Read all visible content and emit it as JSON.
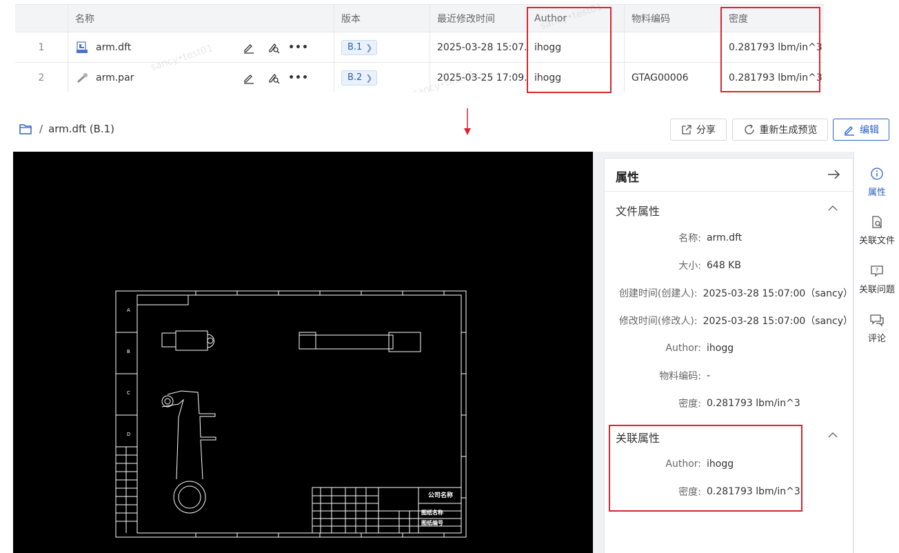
{
  "table": {
    "headers": {
      "name": "名称",
      "version": "版本",
      "modified": "最近修改时间",
      "author": "Author",
      "material_code": "物料编码",
      "density": "密度"
    },
    "rows": [
      {
        "index": "1",
        "name": "arm.dft",
        "icon": "draft-file-icon",
        "version": "B.1",
        "modified": "2025-03-28 15:07...",
        "author": "ihogg",
        "material_code": "",
        "density": "0.281793 lbm/in^3"
      },
      {
        "index": "2",
        "name": "arm.par",
        "icon": "part-file-icon",
        "version": "B.2",
        "modified": "2025-03-25 17:09...",
        "author": "ihogg",
        "material_code": "GTAG00006",
        "density": "0.281793 lbm/in^3"
      }
    ],
    "watermark": "sancy•test01"
  },
  "breadcrumb": {
    "sep": "/",
    "current": "arm.dft (B.1)"
  },
  "toolbar": {
    "share": "分享",
    "regenerate": "重新生成预览",
    "edit": "编辑"
  },
  "drawing": {
    "title_block_company": "公司名称",
    "title_block_drawing_name": "图纸名称",
    "title_block_drawing_no": "图纸编号"
  },
  "panel": {
    "title": "属性",
    "file_section": {
      "title": "文件属性",
      "props": [
        {
          "key": "名称:",
          "value": "arm.dft"
        },
        {
          "key": "大小:",
          "value": "648 KB"
        },
        {
          "key": "创建时间(创建人):",
          "value": "2025-03-28 15:07:00（sancy）"
        },
        {
          "key": "修改时间(修改人):",
          "value": "2025-03-28 15:07:00（sancy）"
        },
        {
          "key": "Author:",
          "value": "ihogg"
        },
        {
          "key": "物料编码:",
          "value": "-"
        },
        {
          "key": "密度:",
          "value": "0.281793 lbm/in^3"
        }
      ]
    },
    "linked_section": {
      "title": "关联属性",
      "props": [
        {
          "key": "Author:",
          "value": "ihogg"
        },
        {
          "key": "密度:",
          "value": "0.281793 lbm/in^3"
        }
      ]
    }
  },
  "rail": {
    "items": [
      {
        "label": "属性",
        "icon": "info-icon",
        "active": true
      },
      {
        "label": "关联文件",
        "icon": "linked-file-icon",
        "active": false
      },
      {
        "label": "关联问题",
        "icon": "question-icon",
        "active": false
      },
      {
        "label": "评论",
        "icon": "comment-icon",
        "active": false
      }
    ]
  },
  "colors": {
    "highlight": "#d9232e",
    "accent": "#2b62c4",
    "version_tag_bg": "#e8f1fc"
  }
}
